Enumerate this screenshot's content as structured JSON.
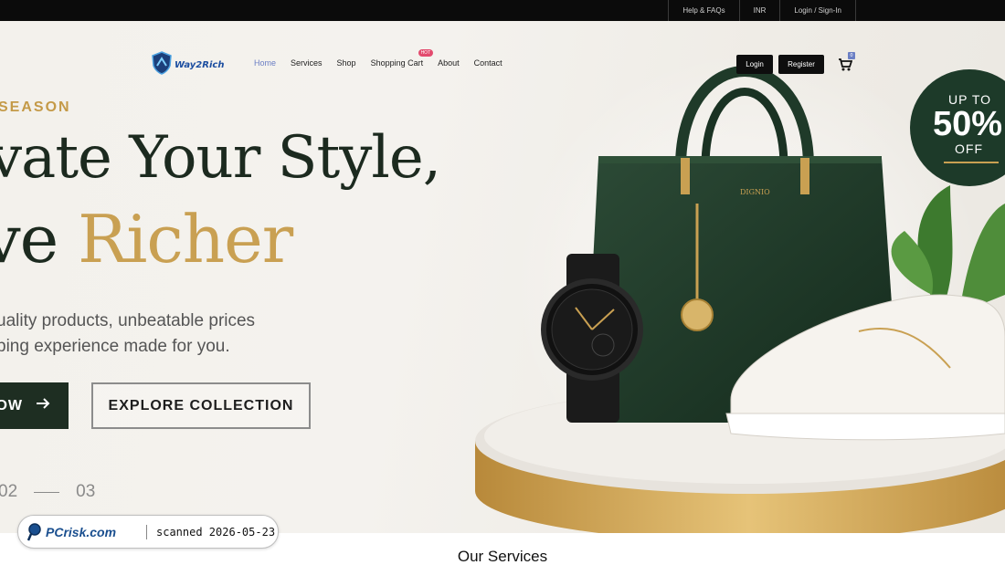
{
  "topbar": {
    "links": [
      "Help & FAQs",
      "INR",
      "Login / Sign-In"
    ]
  },
  "header": {
    "logo_text": "Way2Rich",
    "nav": [
      {
        "label": "Home",
        "active": true
      },
      {
        "label": "Services",
        "active": false
      },
      {
        "label": "Shop",
        "active": false
      },
      {
        "label": "Shopping Cart",
        "active": false,
        "badge": "HOT"
      },
      {
        "label": "About",
        "active": false
      },
      {
        "label": "Contact",
        "active": false
      }
    ],
    "login_label": "Login",
    "register_label": "Register",
    "cart_count": "0",
    "colors": {
      "active_nav": "#6b7fc4",
      "badge": "#e34b6e"
    }
  },
  "hero": {
    "eyebrow": "SEASON",
    "headline_line1": "vate Your Style,",
    "headline_line2_prefix": "ve ",
    "headline_line2_accent": "Richer",
    "subtitle_line1": "uality products, unbeatable prices",
    "subtitle_line2": "ping experience made for you.",
    "primary_button": "OW",
    "secondary_button": "EXPLORE COLLECTION",
    "slide_current": "02",
    "slide_total": "03",
    "colors": {
      "accent_gold": "#c9a052",
      "dark_green": "#1c2a1f"
    }
  },
  "promo": {
    "line1": "UP TO",
    "line2": "50%",
    "line3": "OFF"
  },
  "watermark": {
    "brand": "PCrisk.com",
    "text": "scanned 2026-05-23"
  },
  "services": {
    "title": "Our Services"
  }
}
